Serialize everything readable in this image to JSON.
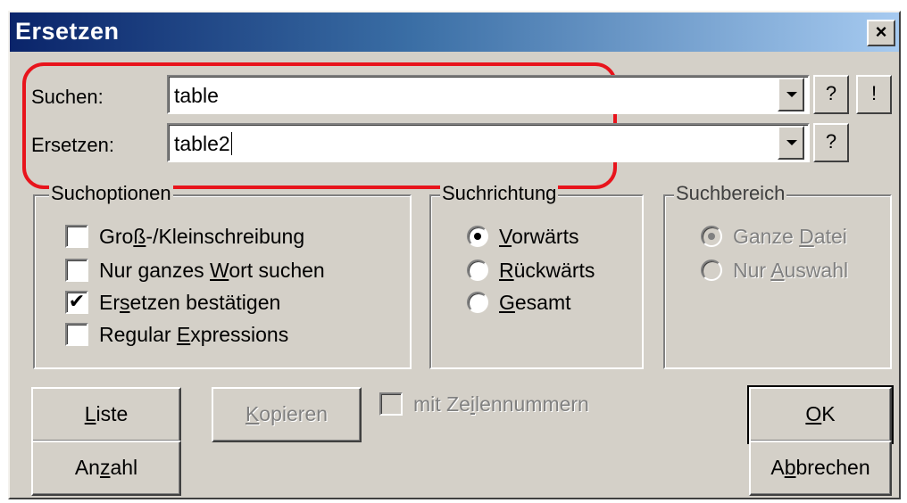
{
  "window": {
    "title": "Ersetzen",
    "close_label": "×"
  },
  "search": {
    "label": "Suchen:",
    "value": "table",
    "help_label": "?",
    "exec_label": "!"
  },
  "replace": {
    "label": "Ersetzen:",
    "value": "table2",
    "help_label": "?"
  },
  "search_options": {
    "title": "Suchoptionen",
    "items": [
      {
        "pre": "Gro",
        "key": "ß",
        "post": "-/Kleinschreibung",
        "checked": false
      },
      {
        "pre": "Nur ganzes ",
        "key": "W",
        "post": "ort suchen",
        "checked": false
      },
      {
        "pre": "Er",
        "key": "s",
        "post": "etzen bestätigen",
        "checked": true
      },
      {
        "pre": "Regular ",
        "key": "E",
        "post": "xpressions",
        "checked": false
      }
    ]
  },
  "direction": {
    "title": "Suchrichtung",
    "items": [
      {
        "pre": "",
        "key": "V",
        "post": "orwärts",
        "checked": true
      },
      {
        "pre": "",
        "key": "R",
        "post": "ückwärts",
        "checked": false
      },
      {
        "pre": "",
        "key": "G",
        "post": "esamt",
        "checked": false
      }
    ]
  },
  "scope": {
    "title": "Suchbereich",
    "items": [
      {
        "pre": "Ganze ",
        "key": "D",
        "post": "atei",
        "checked": true
      },
      {
        "pre": "Nur ",
        "key": "A",
        "post": "uswahl",
        "checked": false
      }
    ]
  },
  "buttons": {
    "liste": {
      "pre": "",
      "key": "L",
      "post": "iste"
    },
    "kopieren": {
      "pre": "",
      "key": "K",
      "post": "opieren"
    },
    "anzahl": {
      "pre": "An",
      "key": "z",
      "post": "ahl"
    },
    "ok": {
      "pre": "",
      "key": "O",
      "post": "K"
    },
    "abbrechen": {
      "pre": "A",
      "key": "b",
      "post": "brechen"
    }
  },
  "line_numbers": {
    "pre": "mit Ze",
    "key": "i",
    "post": "lennummern",
    "checked": false
  },
  "colors": {
    "highlight": "#e8141c",
    "title_start": "#0a246a",
    "title_end": "#a6caf0"
  }
}
